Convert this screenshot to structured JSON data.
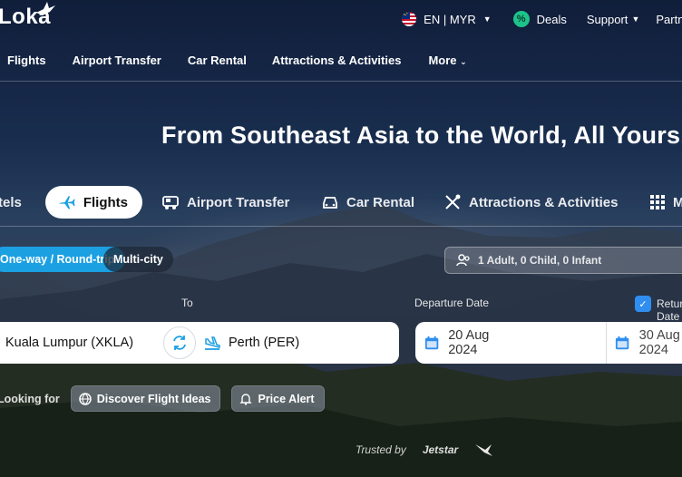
{
  "brand": {
    "logo_text": "Loka"
  },
  "topbar": {
    "locale": "EN | MYR",
    "deals": "Deals",
    "support": "Support",
    "partner": "Partner"
  },
  "nav": [
    "Flights",
    "Airport Transfer",
    "Car Rental",
    "Attractions & Activities",
    "More"
  ],
  "headline": "From Southeast Asia to the World, All Yours.",
  "product_tabs": [
    "Hotels",
    "Flights",
    "Airport Transfer",
    "Car Rental",
    "Attractions & Activities",
    "More"
  ],
  "active_tab": "Flights",
  "trip_types": {
    "selected": "One-way / Round-trip",
    "other": "Multi-city"
  },
  "passengers": "1 Adult, 0 Child, 0 Infant",
  "labels": {
    "to": "To",
    "departure": "Departure Date",
    "return": "Return Date"
  },
  "search": {
    "from": "Kuala Lumpur (XKLA)",
    "to": "Perth (PER)",
    "departure": "20 Aug 2024",
    "return": "30 Aug 2024"
  },
  "looking_for": "Looking for",
  "quick_links": [
    "Discover Flight Ideas",
    "Price Alert"
  ],
  "trusted_by": "Trusted by",
  "partners": [
    "Jetstar"
  ],
  "colors": {
    "accent": "#1ba0e2",
    "date_icon": "#2f8ef0"
  }
}
